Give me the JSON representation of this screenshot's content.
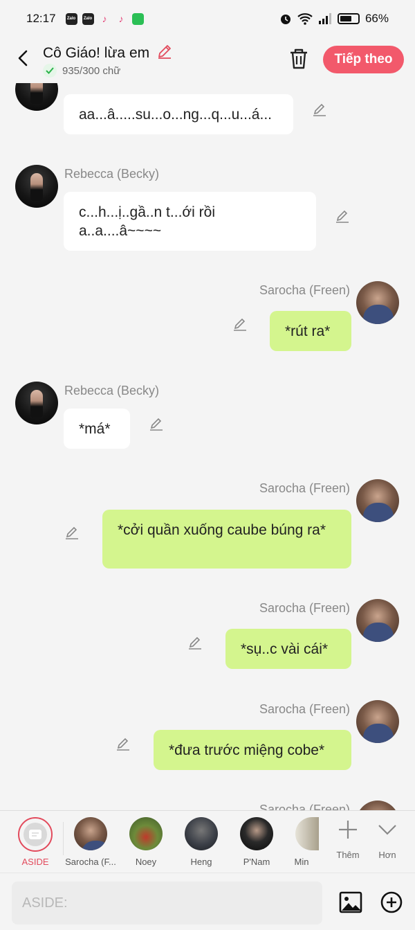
{
  "status_bar": {
    "time": "12:17",
    "notification_icons": [
      "zalo-icon",
      "zalo-icon",
      "tiktok-icon",
      "tiktok-icon",
      "messages-icon"
    ],
    "battery": "66%",
    "battery_level": 0.66
  },
  "header": {
    "title": "Cô Giáo! lừa em",
    "word_count": "935/300 chữ",
    "next_label": "Tiếp theo"
  },
  "messages": [
    {
      "side": "left",
      "speaker": "",
      "text": "aa...â.....su...o...ng...q...u...á..."
    },
    {
      "side": "left",
      "speaker": "Rebecca (Becky)",
      "text": "c...h...ị..gầ..n t...ới rồi\na..a....â~~~~"
    },
    {
      "side": "right",
      "speaker": "Sarocha (Freen)",
      "text": "*rút ra*"
    },
    {
      "side": "left",
      "speaker": "Rebecca (Becky)",
      "text": "*má*"
    },
    {
      "side": "right",
      "speaker": "Sarocha (Freen)",
      "text": "*cởi quần xuống caube búng ra*"
    },
    {
      "side": "right",
      "speaker": "Sarocha (Freen)",
      "text": "*sụ..c vài cái*"
    },
    {
      "side": "right",
      "speaker": "Sarocha (Freen)",
      "text": "*đưa trước miệng cobe*"
    },
    {
      "side": "right",
      "speaker": "Sarocha (Freen)",
      "text": ""
    }
  ],
  "characters": {
    "aside_label": "ASIDE",
    "items": [
      "Sarocha (F...",
      "Noey",
      "Heng",
      "P'Nam",
      "Min"
    ],
    "more_label": "Thêm",
    "collapse_label": "Hơn"
  },
  "input": {
    "placeholder": "ASIDE:"
  },
  "colors": {
    "accent": "#f2596b",
    "right_bubble": "#d4f58e",
    "left_bubble": "#ffffff",
    "background": "#f4f4f4"
  }
}
